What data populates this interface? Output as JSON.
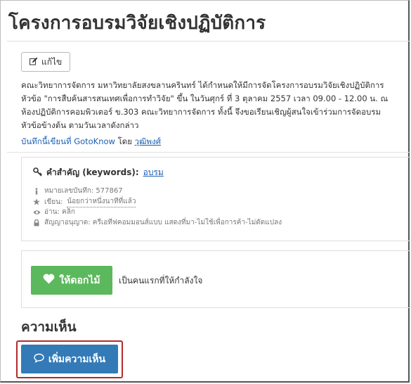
{
  "page": {
    "title": "โครงการอบรมวิจัยเชิงปฏิบัติการ",
    "edit_label": "แก้ไข"
  },
  "article": {
    "lines": [
      "คณะวิทยาการจัดการ มหาวิทยาลัยสงขลานครินทร์  ได้กำหนดให้มีการจัดโครงการอบรมวิจัยเชิงปฏิบัติการ",
      "หัวข้อ \"การสืบค้นสารสนเทศเพื่อการทำวิจัย\" ขึ้น  ในวันศุกร์ ที่ 3 ตุลาคม 2557 เวลา 09.00 - 12.00 น.  ณ",
      "ห้องปฏิบัติการคอมพิวเตอร์ ข.303 คณะวิทยาการจัดการ  ทั้งนี้ จึงขอเรียนเชิญผู้สนใจเข้าร่วมการจัดอบรม",
      "หัวข้อข้างต้น ตามวันเวลาดังกล่าว"
    ]
  },
  "byline": {
    "prefix": "บันทึกนี้เขียนที่ GotoKnow",
    "by": "โดย",
    "author": "วุฒิพงศ์"
  },
  "meta": {
    "keywords_label": "คำสำคัญ (keywords):",
    "keyword": "อบรม",
    "record_number": "หมายเลขบันทึก: 577867",
    "written_label": "เขียน:",
    "written_value": "น้อยกว่าหนึ่งนาทีที่แล้ว",
    "read": "อ่าน: คลิก",
    "license": "สัญญาอนุญาต: ครีเอทีฟคอมมอนส์แบบ แสดงที่มา-ไม่ใช้เพื่อการค้า-ไม่ดัดแปลง"
  },
  "like": {
    "button_label": "ให้ดอกไม้",
    "note": "เป็นคนแรกที่ให้กำลังใจ"
  },
  "comments": {
    "heading": "ความเห็น",
    "add_label": "เพิ่มความเห็น"
  },
  "colors": {
    "like_green": "#5cb85c",
    "comment_blue": "#337ab7",
    "link_blue": "#1a5fb4",
    "highlight_red": "#b02b2b"
  },
  "icons": [
    "edit-icon",
    "key-icon",
    "info-icon",
    "star-icon",
    "eye-icon",
    "lock-icon",
    "heart-icon",
    "comment-bubble-icon"
  ]
}
